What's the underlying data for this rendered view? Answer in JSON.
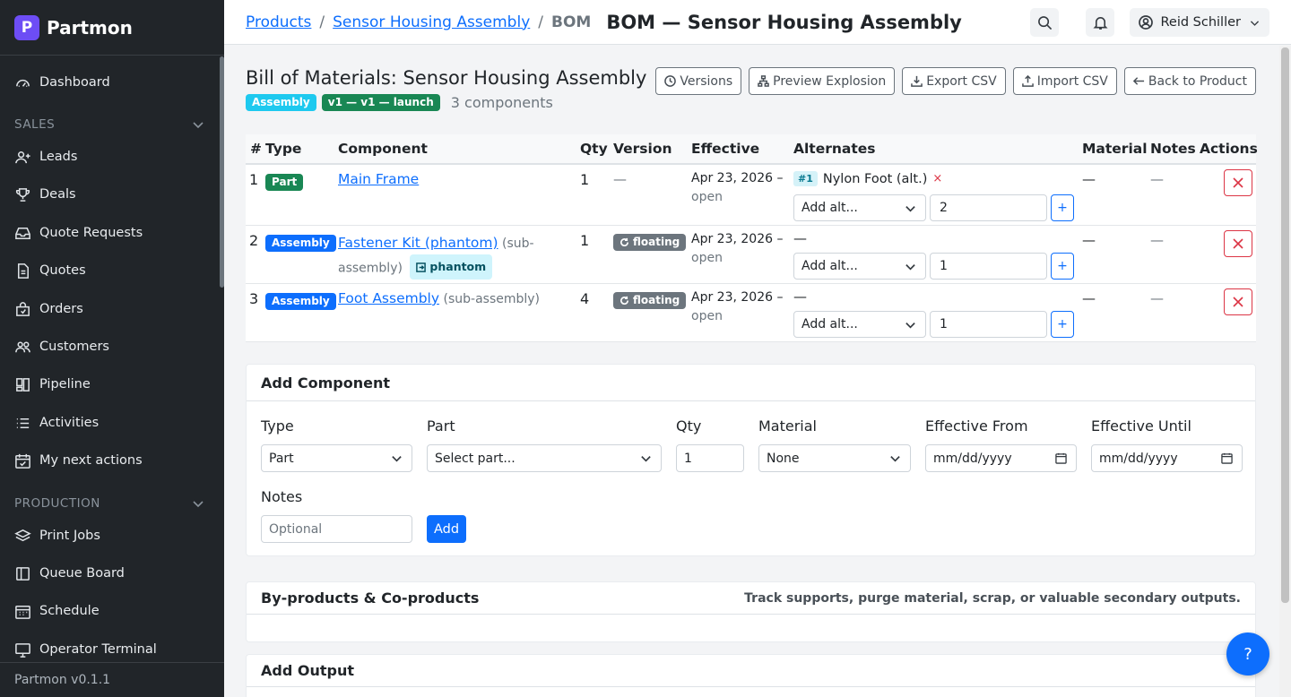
{
  "app": {
    "name": "Partmon",
    "logo_letter": "P",
    "version": "Partmon v0.1.1"
  },
  "sidebar": {
    "items": [
      {
        "label": "Dashboard",
        "icon": "gauge-icon"
      },
      {
        "label": "Leads",
        "icon": "user-plus-icon"
      },
      {
        "label": "Deals",
        "icon": "trophy-icon"
      },
      {
        "label": "Quote Requests",
        "icon": "inbox-icon"
      },
      {
        "label": "Quotes",
        "icon": "document-icon"
      },
      {
        "label": "Orders",
        "icon": "bag-icon"
      },
      {
        "label": "Customers",
        "icon": "people-icon"
      },
      {
        "label": "Pipeline",
        "icon": "kanban-icon"
      },
      {
        "label": "Activities",
        "icon": "list-icon"
      },
      {
        "label": "My next actions",
        "icon": "calendar-check-icon"
      },
      {
        "label": "Print Jobs",
        "icon": "layers-icon"
      },
      {
        "label": "Queue Board",
        "icon": "board-icon"
      },
      {
        "label": "Schedule",
        "icon": "calendar-icon"
      },
      {
        "label": "Operator Terminal",
        "icon": "monitor-icon"
      }
    ],
    "sections": {
      "sales": "SALES",
      "production": "PRODUCTION"
    }
  },
  "topbar": {
    "breadcrumb": [
      "Products",
      "Sensor Housing Assembly",
      "BOM"
    ],
    "separator": "/",
    "title": "BOM — Sensor Housing Assembly",
    "user": "Reid Schiller"
  },
  "bom": {
    "title": "Bill of Materials: Sensor Housing Assembly",
    "type_badge": "Assembly",
    "version_badge": "v1 — v1 — launch",
    "count": "3 components",
    "actions": [
      "Versions",
      "Preview Explosion",
      "Export CSV",
      "Import CSV",
      "Back to Product"
    ]
  },
  "table": {
    "headers": [
      "#",
      "Type",
      "Component",
      "Qty",
      "Version",
      "Effective",
      "Alternates",
      "Material",
      "Notes",
      "Actions"
    ],
    "rows": [
      {
        "num": "1",
        "type": "Part",
        "component": "Main Frame",
        "suffix": "",
        "phantom": "",
        "qty": "1",
        "version": "—",
        "effective_date": "Apr 23, 2026 –",
        "effective_until": "open",
        "alt_rank": "#1",
        "alt_name": "Nylon Foot (alt.)",
        "alt_remove": "×",
        "alternates": "",
        "alt_placeholder": "Add alt...",
        "alt_qty": "2",
        "alt_add": "+",
        "material": "—",
        "notes": "—"
      },
      {
        "num": "2",
        "type": "Assembly",
        "component": "Fastener Kit (phantom)",
        "suffix": "(sub-",
        "suffix2": "assembly)",
        "phantom": "phantom",
        "qty": "1",
        "version": "floating",
        "effective_date": "Apr 23, 2026 –",
        "effective_until": "open",
        "alternates": "—",
        "alt_placeholder": "Add alt...",
        "alt_qty": "1",
        "alt_add": "+",
        "material": "—",
        "notes": "—"
      },
      {
        "num": "3",
        "type": "Assembly",
        "component": "Foot Assembly",
        "suffix": "(sub-assembly)",
        "phantom": "",
        "qty": "4",
        "version": "floating",
        "effective_date": "Apr 23, 2026 –",
        "effective_until": "open",
        "alternates": "—",
        "alt_placeholder": "Add alt...",
        "alt_qty": "1",
        "alt_add": "+",
        "material": "—",
        "notes": "—"
      }
    ]
  },
  "add_component": {
    "title": "Add Component",
    "labels": {
      "type": "Type",
      "part": "Part",
      "qty": "Qty",
      "material": "Material",
      "from": "Effective From",
      "until": "Effective Until",
      "notes": "Notes"
    },
    "values": {
      "type": "Part",
      "part": "Select part...",
      "qty": "1",
      "material": "None",
      "from": "mm/dd/yyyy",
      "until": "mm/dd/yyyy"
    },
    "notes_placeholder": "Optional",
    "submit": "Add"
  },
  "byproducts": {
    "title": "By-products & Co-products",
    "subtitle": "Track supports, purge material, scrap, or valuable secondary outputs."
  },
  "add_output": {
    "title": "Add Output"
  },
  "help": {
    "label": "?"
  }
}
